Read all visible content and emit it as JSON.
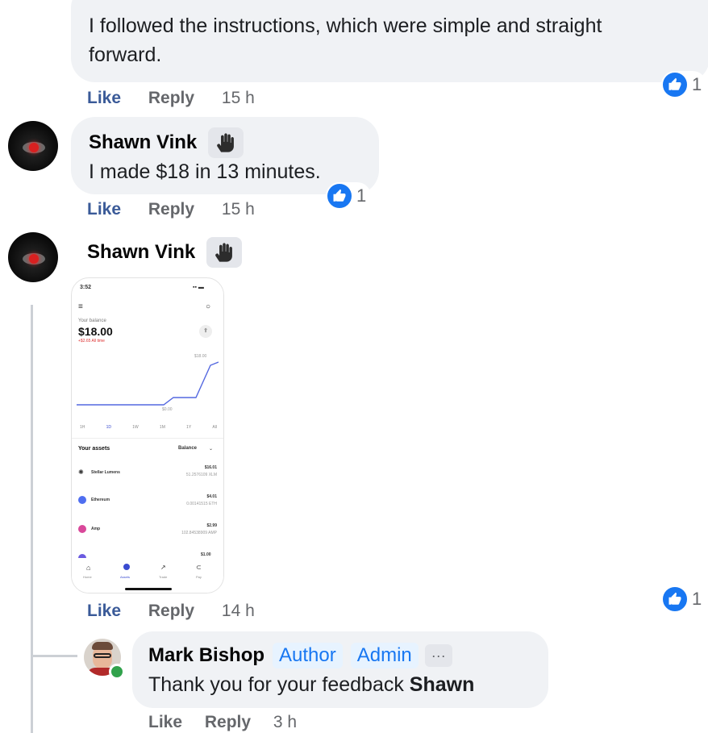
{
  "comments": [
    {
      "text": "I followed the instructions, which were simple and straight forward.",
      "actions": {
        "like": "Like",
        "reply": "Reply",
        "time": "15 h"
      },
      "reactions": "1"
    },
    {
      "author": "Shawn Vink",
      "text": "I made $18 in 13 minutes.",
      "actions": {
        "like": "Like",
        "reply": "Reply",
        "time": "15 h"
      },
      "reactions": "1"
    },
    {
      "author": "Shawn Vink",
      "actions": {
        "like": "Like",
        "reply": "Reply",
        "time": "14 h"
      },
      "reactions": "1",
      "attachment": {
        "status_time": "3:52",
        "balance_label": "Your balance",
        "balance": "$18.00",
        "change": "+$2.65 All time",
        "chart_high": "$18.00",
        "chart_low": "$0.00",
        "ranges": [
          "1H",
          "1D",
          "1W",
          "1M",
          "1Y",
          "All"
        ],
        "assets_label": "Your assets",
        "balance_sort": "Balance",
        "assets": [
          {
            "name": "Stellar Lumens",
            "value": "$16.01",
            "amount": "51.2576109 XLM"
          },
          {
            "name": "Ethereum",
            "value": "$4.01",
            "amount": "0.00141515 ETH"
          },
          {
            "name": "Amp",
            "value": "$2.99",
            "amount": "102.84538909 AMP"
          }
        ],
        "partial_value": "$1.00",
        "tabs": [
          "Home",
          "Assets",
          "Trade",
          "Pay"
        ]
      }
    }
  ],
  "reply": {
    "author": "Mark Bishop",
    "tags": [
      "Author",
      "Admin"
    ],
    "more": "···",
    "text_prefix": "Thank you for your feedback ",
    "text_bold": "Shawn",
    "actions": {
      "like": "Like",
      "reply": "Reply",
      "time": "3 h"
    }
  },
  "colors": {
    "bubble": "#f0f2f5",
    "like_blue": "#1877f2",
    "link": "#3a5a98",
    "meta": "#65676b"
  }
}
